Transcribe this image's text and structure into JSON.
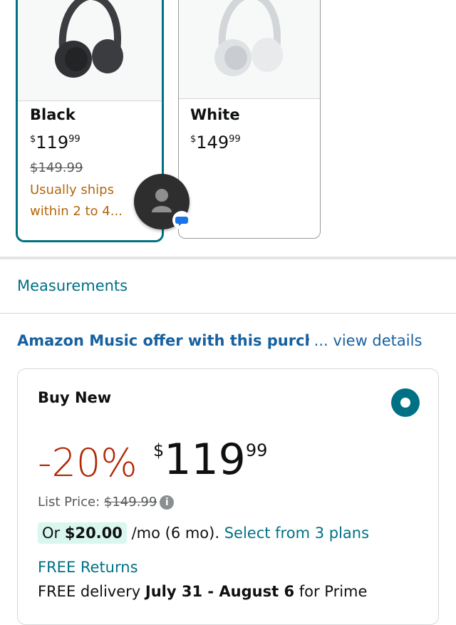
{
  "swatches": [
    {
      "name": "Black",
      "price_symbol": "$",
      "price_whole": "119",
      "price_cents": "99",
      "list_price": "$149.99",
      "shipping_line1": "Usually ships",
      "shipping_line2": "within 2 to 4...",
      "selected": true
    },
    {
      "name": "White",
      "price_symbol": "$",
      "price_whole": "149",
      "price_cents": "99",
      "selected": false
    }
  ],
  "measurements_link": "Measurements",
  "music_offer": {
    "text": "Amazon Music offer with this purch",
    "ellipsis": " ... ",
    "link": "view details"
  },
  "buy_new": {
    "title": "Buy New",
    "discount": "-20%",
    "price_symbol": "$",
    "price_whole": "119",
    "price_cents": "99",
    "list_price_label": "List Price: ",
    "list_price": "$149.99",
    "monthly_prefix": "Or ",
    "monthly_amount": "$20.00",
    "monthly_suffix": " /mo (6 mo). ",
    "plans_link": "Select from 3 plans",
    "returns": "FREE Returns",
    "delivery_prefix": "FREE delivery ",
    "delivery_dates": "July 31 - August 6",
    "delivery_suffix": " for Prime"
  },
  "icons": [
    "headphones-black-image",
    "headphones-white-image",
    "person-icon",
    "chat-icon",
    "info-icon",
    "radio-selected-icon"
  ],
  "colors": {
    "teal": "#007185",
    "link_blue": "#1761a0",
    "discount_red": "#b12704",
    "shipping_orange": "#b3660e",
    "savings_bg": "#d9f7ef"
  }
}
